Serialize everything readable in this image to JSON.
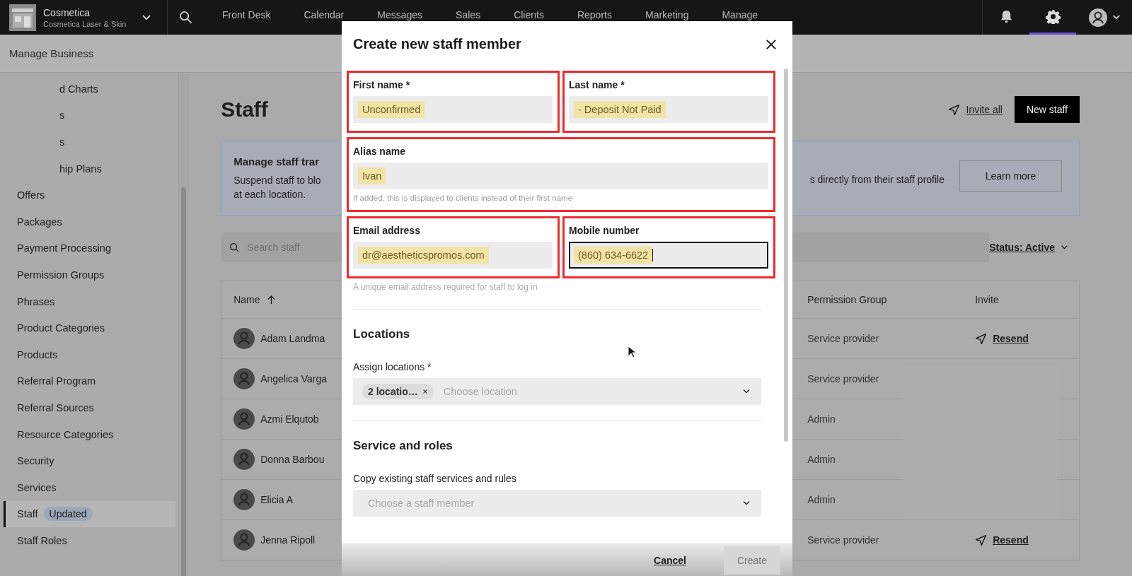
{
  "top_bar": {
    "brand": {
      "name": "Cosmetica",
      "subtitle": "Cosmetica Laser & Skin"
    },
    "nav": [
      {
        "label": "Front Desk"
      },
      {
        "label": "Calendar"
      },
      {
        "label": "Messages"
      },
      {
        "label": "Sales"
      },
      {
        "label": "Clients"
      },
      {
        "label": "Reports"
      },
      {
        "label": "Marketing"
      },
      {
        "label": "Manage"
      }
    ],
    "tools": [
      {
        "kind": "bell",
        "selected": false
      },
      {
        "kind": "gear",
        "selected": true
      }
    ]
  },
  "page_header": {
    "title": "Manage Business"
  },
  "sidebar": {
    "items": [
      {
        "label": "d Charts",
        "kind": "clipped",
        "selected": false
      },
      {
        "label": "s",
        "kind": "clipped",
        "selected": false
      },
      {
        "label": "s",
        "kind": "clipped",
        "selected": false
      },
      {
        "label": "hip Plans",
        "kind": "clipped",
        "selected": false
      },
      {
        "label": "Offers",
        "kind": "item",
        "selected": false
      },
      {
        "label": "Packages",
        "kind": "item",
        "selected": false
      },
      {
        "label": "Payment Processing",
        "kind": "item",
        "selected": false
      },
      {
        "label": "Permission Groups",
        "kind": "item",
        "selected": false
      },
      {
        "label": "Phrases",
        "kind": "item",
        "selected": false
      },
      {
        "label": "Product Categories",
        "kind": "item",
        "selected": false
      },
      {
        "label": "Products",
        "kind": "item",
        "selected": false
      },
      {
        "label": "Referral Program",
        "kind": "item",
        "selected": false
      },
      {
        "label": "Referral Sources",
        "kind": "item",
        "selected": false
      },
      {
        "label": "Resource Categories",
        "kind": "item",
        "selected": false
      },
      {
        "label": "Security",
        "kind": "item",
        "selected": false
      },
      {
        "label": "Services",
        "kind": "item",
        "selected": false
      },
      {
        "label": "Staff",
        "kind": "item",
        "badge": "Updated",
        "selected": true
      },
      {
        "label": "Staff Roles",
        "kind": "item",
        "selected": false
      }
    ]
  },
  "main": {
    "title": "Staff",
    "invite_all": "Invite all",
    "new_staff": "New staff",
    "banner": {
      "title": "Manage staff trar",
      "text_left": [
        "Suspend staff to blo",
        "at each location."
      ],
      "text_right": "s directly from their staff profile",
      "button": "Learn more"
    },
    "search": {
      "placeholder": "Search staff"
    },
    "status_filter": "Status: Active",
    "table": {
      "columns": [
        "Name",
        "Permission Group",
        "Invite"
      ],
      "rows": [
        {
          "name": "Adam Landma",
          "permission_group": "Service provider",
          "invite": "Resend"
        },
        {
          "name": "Angelica Varga",
          "permission_group": "Service provider"
        },
        {
          "name": "Azmi Elqutob",
          "permission_group": "Admin"
        },
        {
          "name": "Donna Barbou",
          "permission_group": "Admin"
        },
        {
          "name": "Elicia A",
          "permission_group": "Admin"
        },
        {
          "name": "Jenna Ripoll",
          "permission_group": "Service provider",
          "invite": "Resend"
        }
      ]
    }
  },
  "modal": {
    "title": "Create new staff member",
    "groups": [
      {
        "highlighted": true,
        "fields": [
          {
            "label": "First name *",
            "value": "Unconfirmed",
            "value_highlighted": true,
            "focused": false
          },
          {
            "label": "Last name *",
            "value": "- Deposit Not Paid",
            "value_highlighted": true,
            "focused": false
          }
        ]
      },
      {
        "highlighted": true,
        "fields": [
          {
            "label": "Alias name",
            "value": "Ivan",
            "value_highlighted": true,
            "focused": false,
            "help": "If added, this is displayed to clients instead of their first name"
          }
        ]
      },
      {
        "highlighted": true,
        "note": "A unique email address required for staff to log in",
        "fields": [
          {
            "label": "Email address",
            "value": "dr@aestheticspromos.com",
            "value_highlighted": true,
            "focused": false
          },
          {
            "label": "Mobile number",
            "value": "(860) 634-6622",
            "value_highlighted": true,
            "focused": true
          }
        ]
      }
    ],
    "locations": {
      "heading": "Locations",
      "label": "Assign locations *",
      "chips": [
        {
          "label": "2 locatio…"
        }
      ],
      "placeholder": "Choose location"
    },
    "services": {
      "heading": "Service and roles",
      "label": "Copy existing staff services and rules",
      "placeholder": "Choose a staff member"
    },
    "footer": {
      "cancel": "Cancel",
      "create": {
        "label": "Create",
        "disabled": true
      }
    }
  }
}
